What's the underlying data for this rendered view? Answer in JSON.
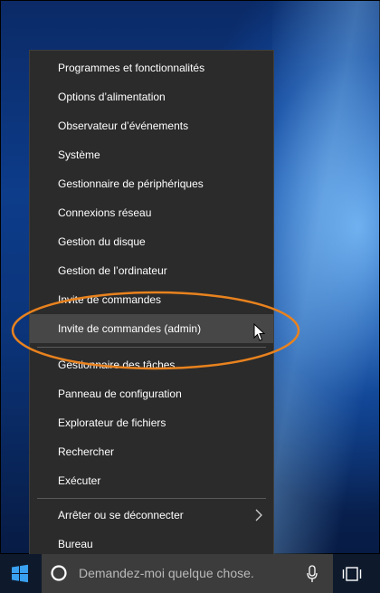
{
  "menu": {
    "items": [
      {
        "label": "Programmes et fonctionnalités"
      },
      {
        "label": "Options d’alimentation"
      },
      {
        "label": "Observateur d’événements"
      },
      {
        "label": "Système"
      },
      {
        "label": "Gestionnaire de périphériques"
      },
      {
        "label": "Connexions réseau"
      },
      {
        "label": "Gestion du disque"
      },
      {
        "label": "Gestion de l’ordinateur"
      },
      {
        "label": "Invite de commandes"
      },
      {
        "label": "Invite de commandes (admin)",
        "state": "hovered"
      },
      {
        "label": "Gestionnaire des tâches"
      },
      {
        "label": "Panneau de configuration"
      },
      {
        "label": "Explorateur de fichiers"
      },
      {
        "label": "Rechercher"
      },
      {
        "label": "Exécuter"
      },
      {
        "label": "Arrêter ou se déconnecter",
        "has_submenu": true
      },
      {
        "label": "Bureau"
      }
    ]
  },
  "highlight": {
    "color": "#e8821e",
    "target": "Invite de commandes (admin)"
  },
  "taskbar": {
    "search_placeholder": "Demandez-moi quelque chose.",
    "icons": [
      "windows-logo-icon",
      "cortana-icon",
      "microphone-icon",
      "task-view-icon"
    ]
  },
  "colors": {
    "menu_bg": "#2b2b2b",
    "hover_bg": "#474747",
    "taskbar_bg": "#0e1a2c",
    "search_bg": "#3c3c3c"
  }
}
